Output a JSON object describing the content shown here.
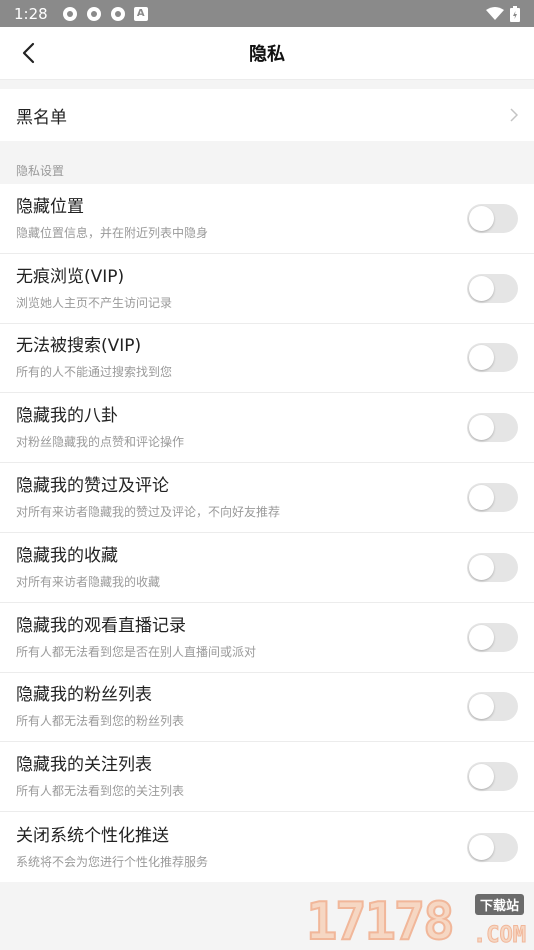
{
  "status_bar": {
    "time": "1:28",
    "a_icon": "A"
  },
  "header": {
    "title": "隐私"
  },
  "blacklist": {
    "label": "黑名单"
  },
  "section": {
    "label": "隐私设置"
  },
  "settings": [
    {
      "title": "隐藏位置",
      "subtitle": "隐藏位置信息，并在附近列表中隐身",
      "enabled": false
    },
    {
      "title": "无痕浏览(VIP)",
      "subtitle": "浏览她人主页不产生访问记录",
      "enabled": false
    },
    {
      "title": "无法被搜索(VIP)",
      "subtitle": "所有的人不能通过搜索找到您",
      "enabled": false
    },
    {
      "title": "隐藏我的八卦",
      "subtitle": "对粉丝隐藏我的点赞和评论操作",
      "enabled": false
    },
    {
      "title": "隐藏我的赞过及评论",
      "subtitle": "对所有来访者隐藏我的赞过及评论，不向好友推荐",
      "enabled": false
    },
    {
      "title": "隐藏我的收藏",
      "subtitle": "对所有来访者隐藏我的收藏",
      "enabled": false
    },
    {
      "title": "隐藏我的观看直播记录",
      "subtitle": "所有人都无法看到您是否在别人直播间或派对",
      "enabled": false
    },
    {
      "title": "隐藏我的粉丝列表",
      "subtitle": "所有人都无法看到您的粉丝列表",
      "enabled": false
    },
    {
      "title": "隐藏我的关注列表",
      "subtitle": "所有人都无法看到您的关注列表",
      "enabled": false
    },
    {
      "title": "关闭系统个性化推送",
      "subtitle": "系统将不会为您进行个性化推荐服务",
      "enabled": false
    }
  ],
  "watermark": {
    "digits": "17178",
    "badge": "下载站",
    "com": ".COM"
  }
}
